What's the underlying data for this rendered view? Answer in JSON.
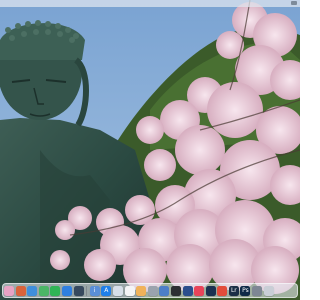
{
  "desktop": {
    "wallpaper": "kamakura-great-buddha-with-cherry-blossoms"
  },
  "menubar": {
    "color": "#e1e8f0"
  },
  "dock": {
    "left_apps": [
      {
        "name": "messages-icon",
        "color": "#e7a3c4"
      },
      {
        "name": "photos-icon",
        "color": "#d9633a"
      },
      {
        "name": "finder-icon",
        "color": "#3f8fdc"
      },
      {
        "name": "maps-icon",
        "color": "#4bb667"
      },
      {
        "name": "facetime-icon",
        "color": "#2fb556"
      },
      {
        "name": "safari-icon",
        "color": "#2f7fe0"
      },
      {
        "name": "github-icon",
        "color": "#36495e"
      }
    ],
    "right_apps": [
      {
        "name": "info-icon",
        "color": "#5a8fd8",
        "glyph": "i"
      },
      {
        "name": "app-store-icon",
        "color": "#1e7fea",
        "glyph": "A"
      },
      {
        "name": "mail-icon",
        "color": "#d7dfe9"
      },
      {
        "name": "calendar-icon",
        "color": "#f4f4f6"
      },
      {
        "name": "photos-gallery-icon",
        "color": "#f0b25a"
      },
      {
        "name": "news-icon",
        "color": "#9aa3ad"
      },
      {
        "name": "launchpad-icon",
        "color": "#4d7fc7"
      },
      {
        "name": "terminal-icon",
        "color": "#2d2f33"
      },
      {
        "name": "code-editor-icon",
        "color": "#2b4e8c"
      },
      {
        "name": "music-icon",
        "color": "#e8445a"
      },
      {
        "name": "photoshop-icon",
        "color": "#1a3150"
      },
      {
        "name": "chrome-icon",
        "color": "#e24c3b"
      },
      {
        "name": "lightroom-icon",
        "color": "#1c2f46",
        "glyph": "Lr"
      },
      {
        "name": "photoshop-ps-icon",
        "color": "#0f2a48",
        "glyph": "Ps"
      },
      {
        "name": "system-settings-icon",
        "color": "#7e8794"
      },
      {
        "name": "trash-icon",
        "color": "#c9ced6"
      }
    ]
  }
}
